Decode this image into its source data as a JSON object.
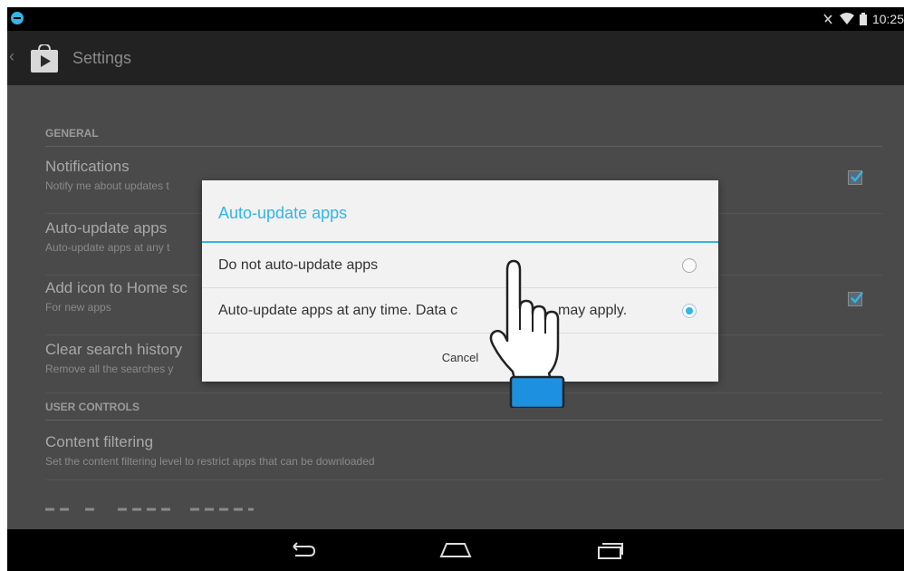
{
  "status_bar": {
    "time": "10:25",
    "icons": [
      "app-notification-icon",
      "mute-icon",
      "wifi-icon",
      "battery-icon"
    ]
  },
  "action_bar": {
    "title": "Settings",
    "icon": "play-store-icon"
  },
  "sections": {
    "general": {
      "header": "GENERAL",
      "rows": [
        {
          "title": "Notifications",
          "subtitle": "Notify me about updates t",
          "checked": true
        },
        {
          "title": "Auto-update apps",
          "subtitle": "Auto-update apps at any t"
        },
        {
          "title": "Add icon to Home sc",
          "subtitle": "For new apps",
          "checked": true
        },
        {
          "title": "Clear search history",
          "subtitle": "Remove all the searches y"
        }
      ]
    },
    "user_controls": {
      "header": "USER CONTROLS",
      "rows": [
        {
          "title": "Content filtering",
          "subtitle": "Set the content filtering level to restrict apps that can be downloaded"
        }
      ]
    }
  },
  "dialog": {
    "title": "Auto-update apps",
    "options": [
      {
        "label": "Do not auto-update apps",
        "selected": false
      },
      {
        "label": "Auto-update apps at any time. Data c",
        "label_tail": "may apply.",
        "selected": true
      }
    ],
    "cancel_label": "Cancel"
  },
  "colors": {
    "accent": "#33b5e5",
    "background": "#4a4a4a",
    "dialog_bg": "#f2f2f2",
    "pointer_cuff": "#1e90e0"
  },
  "navigation": {
    "icons": [
      "back-icon",
      "home-icon",
      "recents-icon"
    ]
  }
}
